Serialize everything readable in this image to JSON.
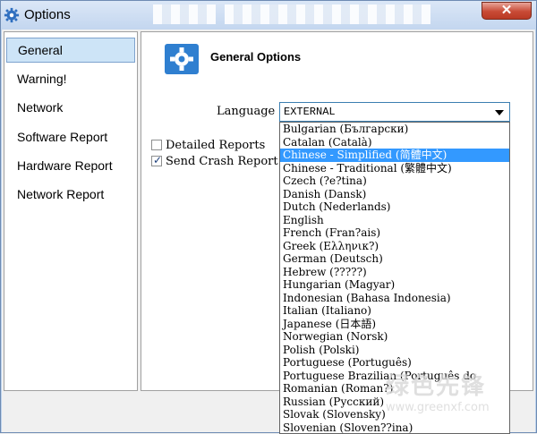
{
  "window": {
    "title": "Options"
  },
  "sidebar": {
    "items": [
      {
        "label": "General"
      },
      {
        "label": "Warning!"
      },
      {
        "label": "Network"
      },
      {
        "label": "Software Report"
      },
      {
        "label": "Hardware Report"
      },
      {
        "label": "Network Report"
      }
    ]
  },
  "main": {
    "header_title": "General Options",
    "language_label": "Language",
    "language_value": "EXTERNAL",
    "checkboxes": [
      {
        "label": "Detailed Reports",
        "checked": false
      },
      {
        "label": "Send Crash Report",
        "checked": true
      }
    ]
  },
  "dropdown": {
    "options": [
      "Bulgarian (Български)",
      "Catalan (Català)",
      "Chinese - Simplified (简體中文)",
      "Chinese - Traditional (繁體中文)",
      "Czech (?e?tina)",
      "Danish (Dansk)",
      "Dutch (Nederlands)",
      "English",
      "French (Fran?ais)",
      "Greek (Ελληνικ?)",
      "German (Deutsch)",
      "Hebrew (?????)",
      "Hungarian (Magyar)",
      "Indonesian (Bahasa Indonesia)",
      "Italian (Italiano)",
      "Japanese (日本語)",
      "Norwegian (Norsk)",
      "Polish (Polski)",
      "Portuguese (Português)",
      "Portuguese Brazilian (Português do",
      "Romanian (Roman?)",
      "Russian (Русский)",
      "Slovak (Slovensky)",
      "Slovenian (Sloven??ina)"
    ],
    "selected_index": 2
  },
  "watermark": {
    "text_large": "绿色先锋",
    "text_small": "www.greenxf.com"
  },
  "colors": {
    "selection": "#3399ff",
    "sidebar_selected": "#cde4f7",
    "close_button": "#c84a35"
  }
}
